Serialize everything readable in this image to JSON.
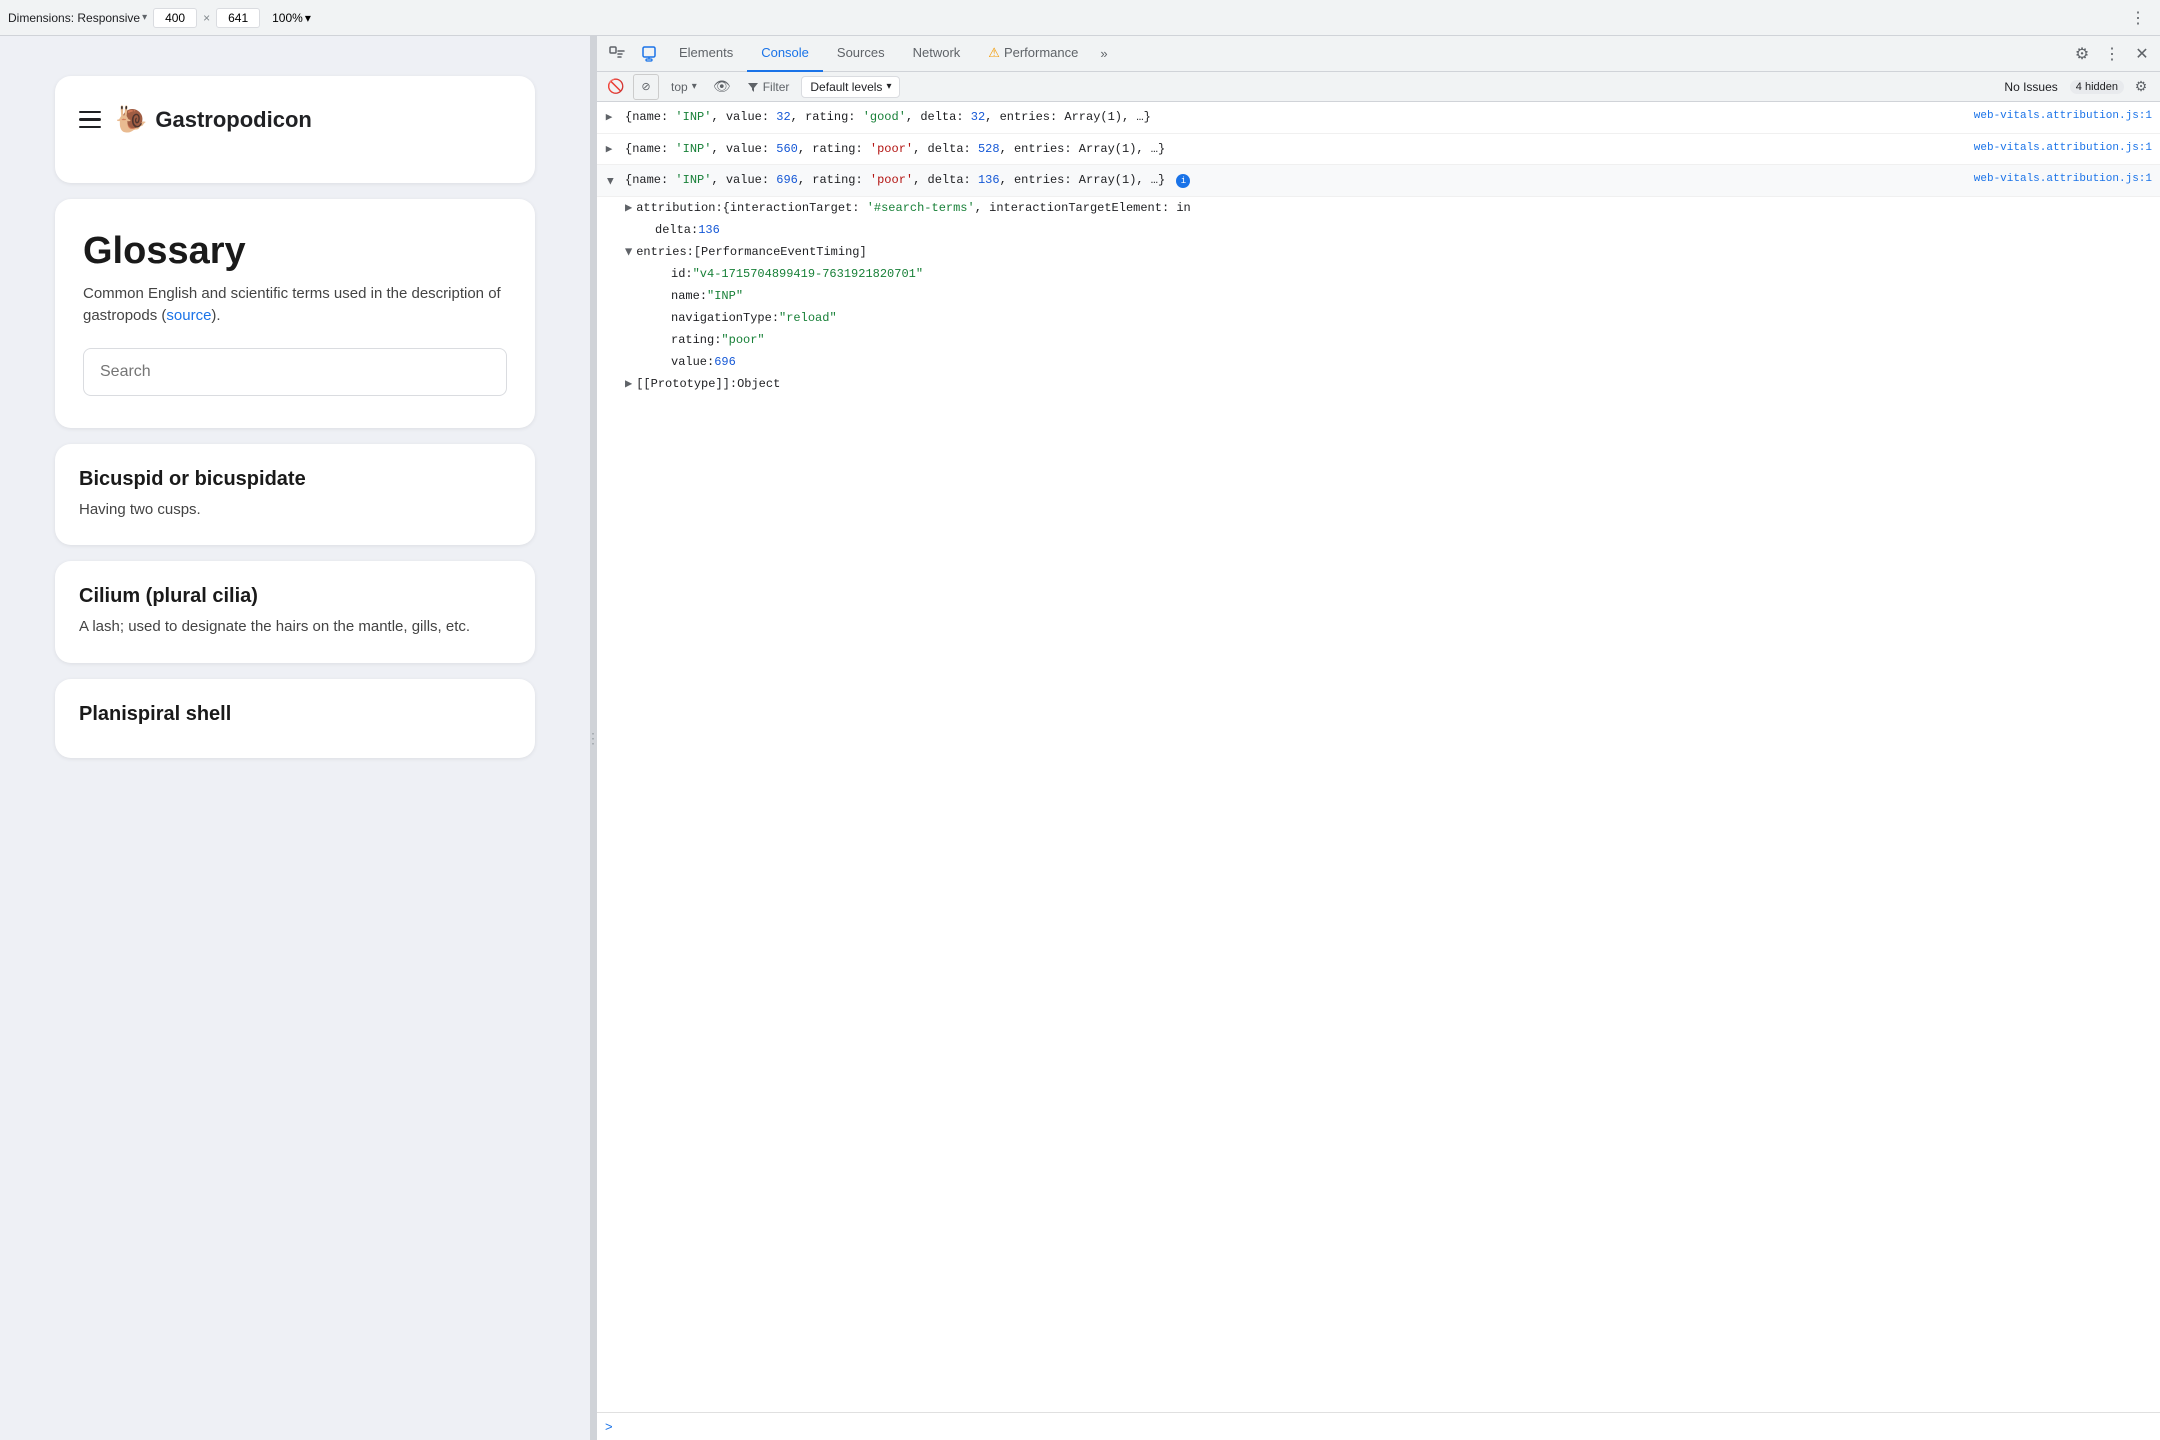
{
  "topbar": {
    "dimensions_label": "Dimensions: Responsive",
    "width_value": "400",
    "height_value": "641",
    "zoom_value": "100%",
    "more_icon": "⋮"
  },
  "site": {
    "logo_text": "Gastropodicon",
    "snail_emoji": "🐌",
    "glossary_title": "Glossary",
    "glossary_desc_text": "Common English and scientific terms used in the description of gastropods (",
    "glossary_source_link": "source",
    "glossary_desc_suffix": ").",
    "search_placeholder": "Search",
    "terms": [
      {
        "title": "Bicuspid or bicuspidate",
        "def": "Having two cusps."
      },
      {
        "title": "Cilium (plural cilia)",
        "def": "A lash; used to designate the hairs on the mantle, gills, etc."
      },
      {
        "title": "Planispiral shell",
        "def": ""
      }
    ]
  },
  "devtools": {
    "tabs": [
      {
        "id": "elements",
        "label": "Elements",
        "active": false
      },
      {
        "id": "console",
        "label": "Console",
        "active": true
      },
      {
        "id": "sources",
        "label": "Sources",
        "active": false
      },
      {
        "id": "network",
        "label": "Network",
        "active": false
      },
      {
        "id": "performance",
        "label": "Performance",
        "active": false
      }
    ],
    "more_label": "»",
    "toolbar": {
      "top_label": "top",
      "filter_label": "Filter",
      "default_levels_label": "Default levels",
      "no_issues_label": "No Issues",
      "hidden_count": "4 hidden"
    },
    "console_entries": [
      {
        "id": "row1",
        "collapsed": true,
        "link": "web-vitals.attribution.js:1",
        "text": "{name: 'INP', value: 32, rating: 'good', delta: 32, entries: Array(1), …}"
      },
      {
        "id": "row2",
        "collapsed": true,
        "link": "web-vitals.attribution.js:1",
        "text": "{name: 'INP', value: 560, rating: 'poor', delta: 528, entries: Array(1), …}"
      },
      {
        "id": "row3",
        "collapsed": false,
        "link": "web-vitals.attribution.js:1",
        "summary_text": "{name: 'INP', value: 696, rating: 'poor', delta: 136, entries: Array(1), …}",
        "info_badge": "i",
        "children": [
          {
            "level": 1,
            "type": "expandable",
            "key": "attribution",
            "value": "{interactionTarget: '#search-terms', interactionTargetElement: in",
            "expanded": false
          },
          {
            "level": 2,
            "type": "plain",
            "key": "delta",
            "value": "136"
          },
          {
            "level": 1,
            "type": "expandable",
            "key": "entries",
            "value": "[PerformanceEventTiming]",
            "expanded": true
          },
          {
            "level": 2,
            "type": "plain",
            "key": "id",
            "value": "\"v4-1715704899419-7631921820701\""
          },
          {
            "level": 2,
            "type": "plain",
            "key": "name",
            "value": "\"INP\""
          },
          {
            "level": 2,
            "type": "plain",
            "key": "navigationType",
            "value": "\"reload\""
          },
          {
            "level": 2,
            "type": "plain",
            "key": "rating",
            "value": "\"poor\""
          },
          {
            "level": 2,
            "type": "plain",
            "key": "value",
            "value": "696"
          },
          {
            "level": 1,
            "type": "expandable",
            "key": "[[Prototype]]",
            "value": "Object",
            "expanded": false
          }
        ]
      }
    ],
    "prompt_caret": ">"
  }
}
